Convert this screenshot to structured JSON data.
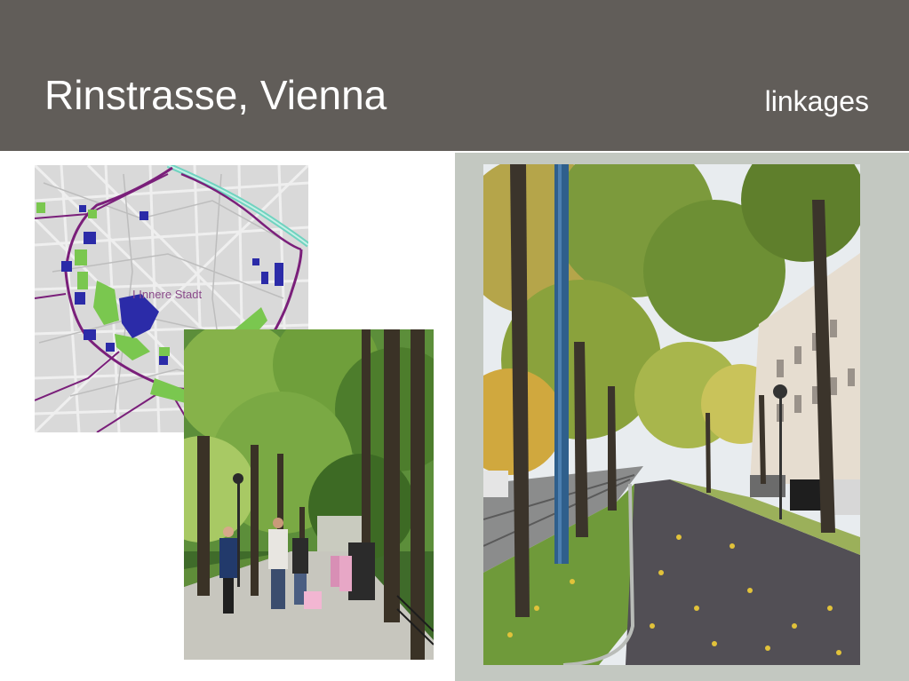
{
  "slide": {
    "title": "Rinstrasse, Vienna",
    "subtitle": "linkages"
  },
  "map": {
    "label": "I Innere Stadt"
  },
  "colors": {
    "header": "#615d59",
    "panel": "#c3c8c1",
    "road": "#7a1f7a",
    "park": "#7ac74f",
    "building": "#2b2ba8"
  }
}
